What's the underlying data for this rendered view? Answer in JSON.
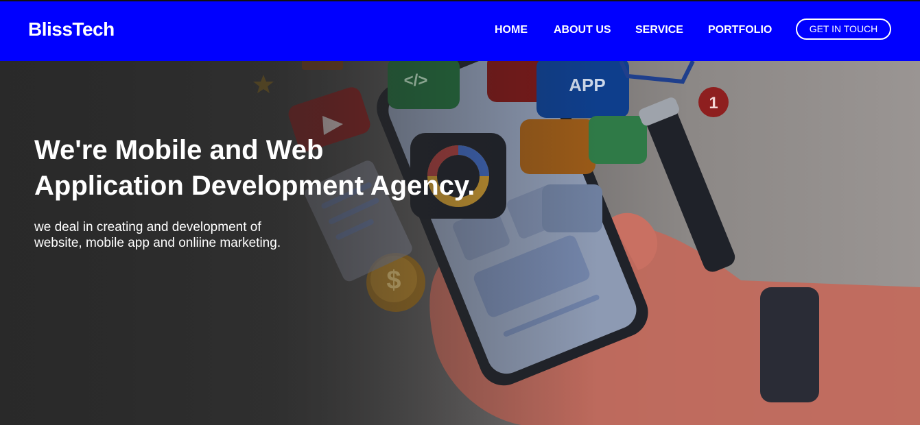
{
  "header": {
    "logo": "BlissTech",
    "nav": [
      {
        "label": "HOME"
      },
      {
        "label": "ABOUT US"
      },
      {
        "label": "SERVICE"
      },
      {
        "label": "PORTFOLIO"
      }
    ],
    "cta_label": "GET IN TOUCH"
  },
  "hero": {
    "title_line1": "We're Mobile and Web",
    "title_line2": "Application Development Agency.",
    "subtitle_line1": "we deal in creating and development of",
    "subtitle_line2": "website, mobile app and onliine marketing.",
    "illustration": {
      "code_tile": "</>",
      "app_tile": "APP",
      "notification_count": "1",
      "coin_symbol": "$"
    }
  },
  "colors": {
    "header_bg": "#0000ff",
    "text": "#ffffff"
  }
}
